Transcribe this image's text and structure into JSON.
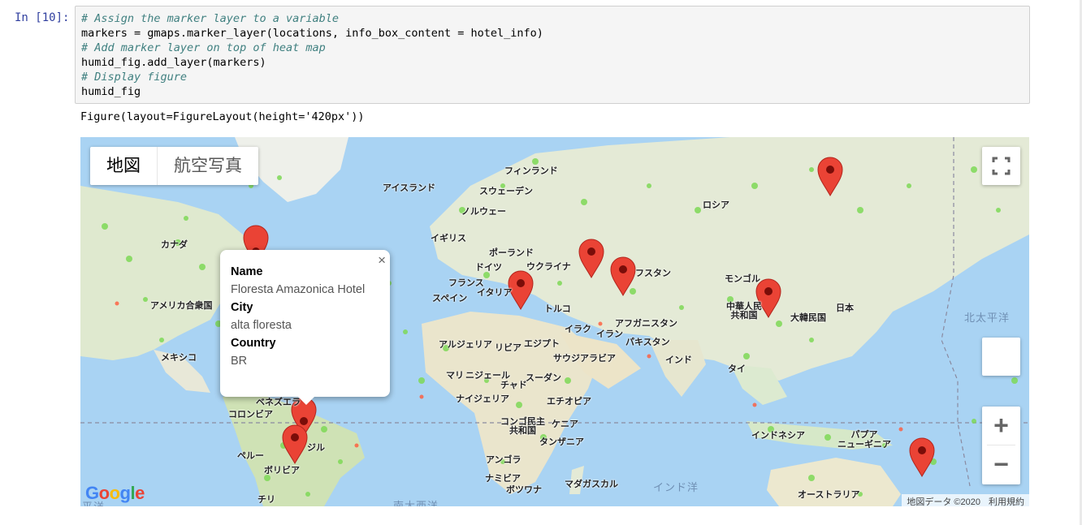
{
  "cell": {
    "prompt": "In [10]:",
    "code": [
      {
        "kind": "comment",
        "text": "# Assign the marker layer to a variable"
      },
      {
        "kind": "code",
        "text": "markers = gmaps.marker_layer(locations, info_box_content = hotel_info)"
      },
      {
        "kind": "comment",
        "text": "# Add marker layer on top of heat map"
      },
      {
        "kind": "code",
        "text": "humid_fig.add_layer(markers)"
      },
      {
        "kind": "comment",
        "text": "# Display figure"
      },
      {
        "kind": "code",
        "text": "humid_fig"
      }
    ],
    "output_text": "Figure(layout=FigureLayout(height='420px'))"
  },
  "map": {
    "map_type": {
      "map": "地図",
      "satellite": "航空写真"
    },
    "infobox": {
      "name_label": "Name",
      "name_value": "Floresta Amazonica Hotel",
      "city_label": "City",
      "city_value": "alta floresta",
      "country_label": "Country",
      "country_value": "BR",
      "close": "×"
    },
    "labels": {
      "finland": "フィンランド",
      "iceland": "アイスランド",
      "sweden": "スウェーデン",
      "norway": "ノルウェー",
      "russia": "ロシア",
      "uk": "イギリス",
      "poland": "ポーランド",
      "germany": "ドイツ",
      "ukraine": "ウクライナ",
      "france": "フランス",
      "italy": "イタリア",
      "spain": "スペイン",
      "kazakhstan": "フスタン",
      "mongolia": "モンゴル",
      "canada": "カナダ",
      "usa": "アメリカ合衆国",
      "china": "中華人民\n共和国",
      "japan": "日本",
      "korea": "大韓民国",
      "turkey": "トルコ",
      "iraq": "イラク",
      "iran": "イラン",
      "afghanistan": "アフガニスタン",
      "pakistan": "パキスタン",
      "algeria": "アルジェリア",
      "libya": "リビア",
      "egypt": "エジプト",
      "saudi": "サウジアラビア",
      "india": "インド",
      "mexico": "メキシコ",
      "mali": "マリ",
      "niger": "ニジェール",
      "chad": "チャド",
      "sudan": "スーダン",
      "thailand": "タイ",
      "nigeria": "ナイジェリア",
      "ethiopia": "エチオピア",
      "venezuela": "ベネズエラ",
      "colombia": "コロンビア",
      "brazil": "ジル",
      "drc": "コンゴ民主\n共和国",
      "kenya": "ケニア",
      "tanzania": "タンザニア",
      "peru": "ペルー",
      "bolivia": "ボリビア",
      "angola": "アンゴラ",
      "namibia": "ナミビア",
      "botswana": "ボツワナ",
      "madagascar": "マダガスカル",
      "indonesia": "インドネシア",
      "png": "パプア\nニューギニア",
      "australia": "オーストラリア",
      "chile": "チリ",
      "south_atlantic": "南大西洋",
      "indian_ocean": "インド洋",
      "north_pacific": "北太平洋",
      "pacific_left": "平洋"
    },
    "google_logo": "Google",
    "attribution": {
      "data": "地図データ ©2020",
      "terms": "利用規約"
    },
    "zoom_in": "+",
    "zoom_out": "−"
  }
}
